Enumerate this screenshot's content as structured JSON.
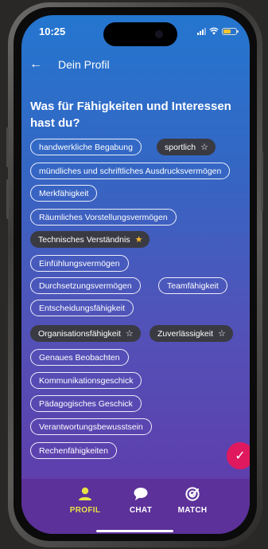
{
  "status_bar": {
    "time": "10:25"
  },
  "header": {
    "title": "Dein Profil"
  },
  "question": "Was für Fähigkeiten und Interessen hast du?",
  "chips": [
    {
      "label": "handwerkliche Begabung",
      "selected": false
    },
    {
      "label": "sportlich",
      "selected": true,
      "star": "outline"
    },
    {
      "label": "mündliches und schriftliches Ausdrucksvermögen",
      "selected": false
    },
    {
      "label": "Merkfähigkeit",
      "selected": false
    },
    {
      "label": "Räumliches Vorstellungsvermögen",
      "selected": false
    },
    {
      "label": "Technisches Verständnis",
      "selected": true,
      "star": "filled"
    },
    {
      "label": "Einfühlungsvermögen",
      "selected": false
    },
    {
      "label": "Durchsetzungsvermögen",
      "selected": false
    },
    {
      "label": "Teamfähigkeit",
      "selected": false
    },
    {
      "label": "Entscheidungsfähigkeit",
      "selected": false
    },
    {
      "label": "Organisationsfähigkeit",
      "selected": true,
      "star": "outline"
    },
    {
      "label": "Zuverlässigkeit",
      "selected": true,
      "star": "outline"
    },
    {
      "label": "Genaues Beobachten",
      "selected": false
    },
    {
      "label": "Kommunikationsgeschick",
      "selected": false
    },
    {
      "label": "Pädagogisches Geschick",
      "selected": false
    },
    {
      "label": "Verantwortungsbewusstsein",
      "selected": false
    },
    {
      "label": "Rechenfähigkeiten",
      "selected": false
    }
  ],
  "icons": {
    "star_outline": "☆",
    "star_filled": "★",
    "check": "✓",
    "back": "←"
  },
  "bottom_nav": [
    {
      "label": "PROFIL",
      "icon": "person-icon",
      "active": true
    },
    {
      "label": "CHAT",
      "icon": "chat-bubble-icon",
      "active": false
    },
    {
      "label": "MATCH",
      "icon": "target-check-icon",
      "active": false
    }
  ],
  "colors": {
    "gradient_top": "#2476cf",
    "gradient_bottom": "#6238a8",
    "chip_selected_bg": "#3a3a42",
    "star_filled": "#f5b82e",
    "fab": "#e0195f",
    "nav_bg": "#5c3199",
    "nav_active": "#e8e345"
  }
}
